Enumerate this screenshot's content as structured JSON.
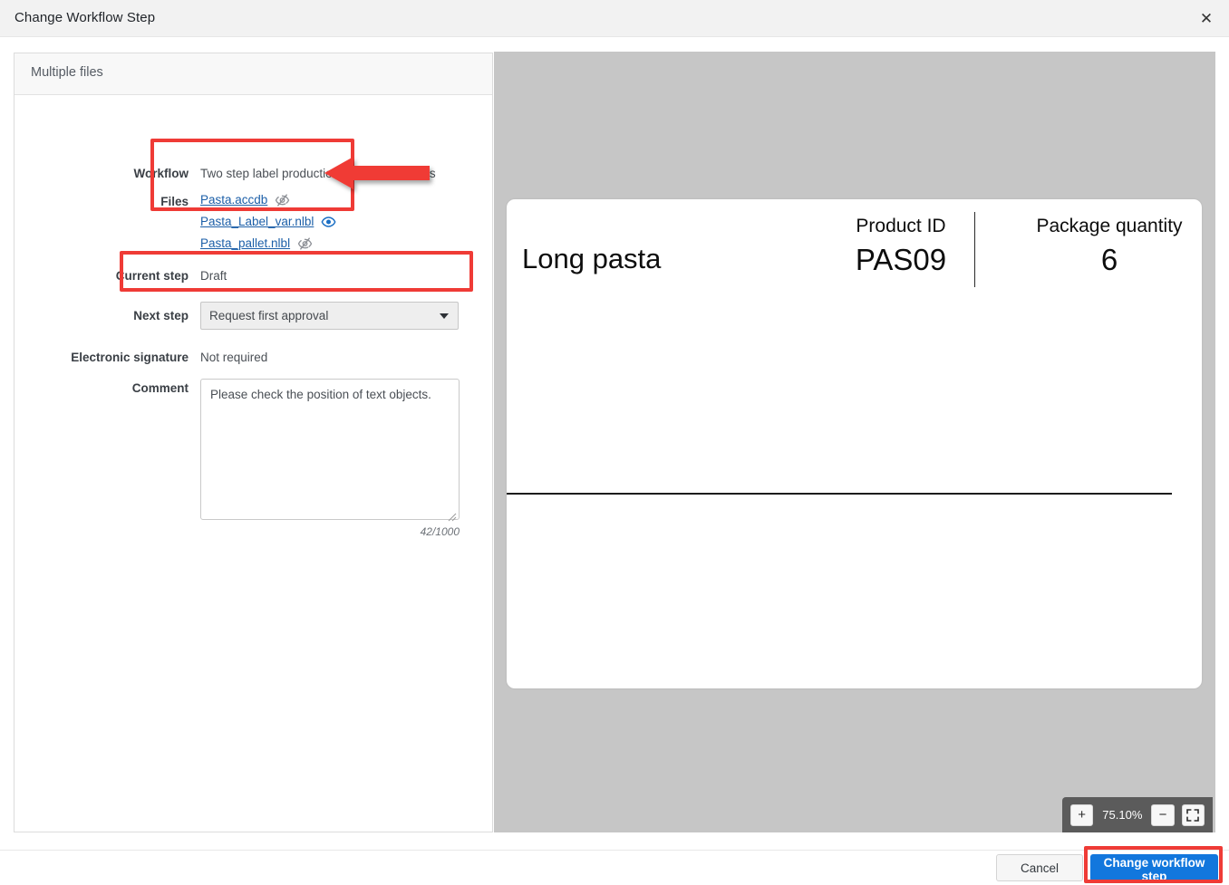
{
  "window": {
    "title": "Change Workflow Step",
    "close_label": "✕",
    "close_icon": "close-icon"
  },
  "panel": {
    "tab_label": "Multiple files"
  },
  "form": {
    "workflow": {
      "label": "Workflow",
      "value": "Two step label production approval process"
    },
    "files": {
      "label": "Files",
      "items": [
        {
          "name": "Pasta.accdb",
          "visibility_icon": "eye-slash-icon",
          "visible": false
        },
        {
          "name": "Pasta_Label_var.nlbl",
          "visibility_icon": "eye-icon",
          "visible": true
        },
        {
          "name": "Pasta_pallet.nlbl",
          "visibility_icon": "eye-slash-icon",
          "visible": false
        }
      ]
    },
    "current_step": {
      "label": "Current step",
      "value": "Draft"
    },
    "next_step": {
      "label": "Next step",
      "selected": "Request first approval",
      "caret_icon": "chevron-down-icon"
    },
    "electronic_signature": {
      "label": "Electronic signature",
      "value": "Not required"
    },
    "comment": {
      "label": "Comment",
      "value": "Please check the position of text objects.",
      "placeholder": "",
      "counter": "42/1000"
    }
  },
  "preview": {
    "label_card": {
      "product_name": "Long pasta",
      "product_id_caption": "Product ID",
      "product_id_value": "PAS09",
      "package_quantity_caption": "Package quantity",
      "package_quantity_value": "6"
    },
    "zoom": {
      "zoom_in_label": "+",
      "level": "75.10%",
      "zoom_out_label": "−",
      "fit_icon": "fit-to-screen-icon"
    }
  },
  "footer": {
    "cancel_label": "Cancel",
    "submit_label": "Change workflow step"
  },
  "colors": {
    "accent": "#1277dd",
    "link": "#1c5fa8",
    "annotation": "#ef3b36",
    "preview_bg": "#c6c6c6"
  }
}
